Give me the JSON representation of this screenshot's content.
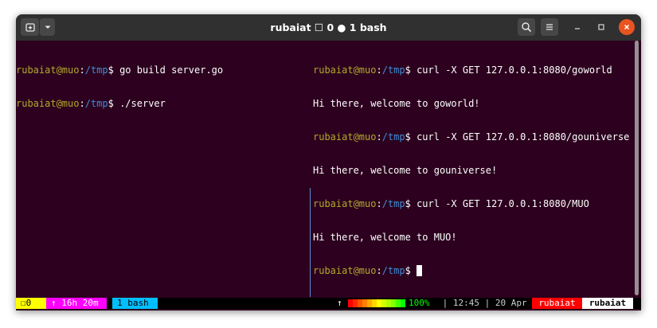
{
  "window": {
    "title": "rubaiat ☐ 0 ● 1 bash"
  },
  "titlebar": {
    "new_tab_icon": "new-tab-icon",
    "menu_icon": "chevron-down-icon",
    "search_icon": "search-icon",
    "hamburger_icon": "hamburger-icon"
  },
  "left_pane": {
    "lines": [
      {
        "user": "rubaiat@muo",
        "sep": ":",
        "path": "/tmp",
        "prompt": "$",
        "command": " go build server.go"
      },
      {
        "user": "rubaiat@muo",
        "sep": ":",
        "path": "/tmp",
        "prompt": "$",
        "command": " ./server"
      }
    ]
  },
  "right_pane": {
    "lines": [
      {
        "type": "prompt",
        "user": "rubaiat@muo",
        "sep": ":",
        "path": "/tmp",
        "prompt": "$",
        "command": " curl -X GET 127.0.0.1:8080/goworld"
      },
      {
        "type": "output",
        "text": "Hi there, welcome to goworld!"
      },
      {
        "type": "prompt",
        "user": "rubaiat@muo",
        "sep": ":",
        "path": "/tmp",
        "prompt": "$",
        "command": " curl -X GET 127.0.0.1:8080/gouniverse"
      },
      {
        "type": "output",
        "text": "Hi there, welcome to gouniverse!"
      },
      {
        "type": "prompt",
        "user": "rubaiat@muo",
        "sep": ":",
        "path": "/tmp",
        "prompt": "$",
        "command": " curl -X GET 127.0.0.1:8080/MUO"
      },
      {
        "type": "output",
        "text": "Hi there, welcome to MUO!"
      },
      {
        "type": "prompt",
        "user": "rubaiat@muo",
        "sep": ":",
        "path": "/tmp",
        "prompt": "$",
        "command": " "
      }
    ]
  },
  "statusbar": {
    "window_indicator": "☐0",
    "uptime": "↑ 16h 20m",
    "active_tab": "1 bash",
    "arrow": "↑",
    "battery_percent": "100%",
    "rest": " | 12:45 | 20 Apr",
    "host": "rubaiat",
    "user": "rubaiat"
  },
  "colors": {
    "terminal_bg": "#2c001e",
    "user": "#b5a82c",
    "path": "#3f8fd6"
  }
}
